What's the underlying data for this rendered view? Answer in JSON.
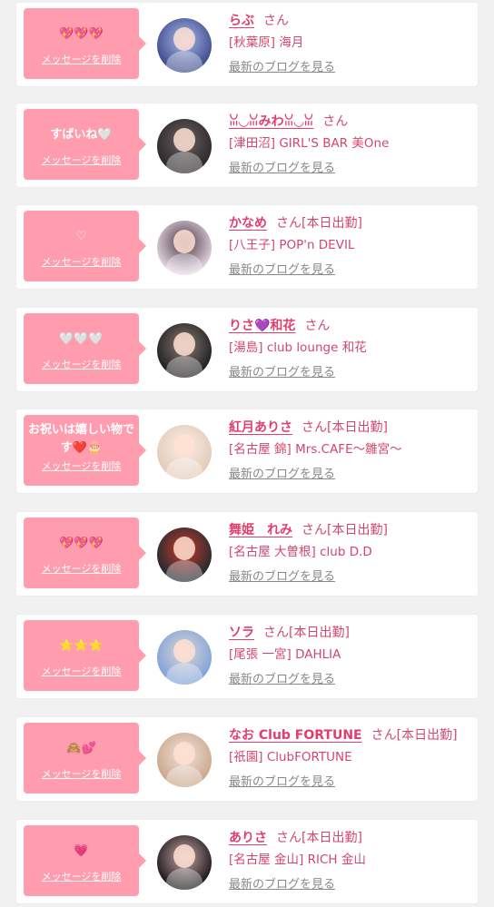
{
  "delete_label": "メッセージを削除",
  "blog_label": "最新のブログを見る",
  "san_label": "さん",
  "colors": {
    "bubble": "#ff9cad",
    "accent": "#e23e6b",
    "shop": "#d4476c",
    "link": "#888888"
  },
  "cards": [
    {
      "message": "💖💖💖",
      "name": "らぶ",
      "status": "",
      "shop": "[秋葉原] 海月",
      "avatar_colors": [
        "#3a4a8a",
        "#a9b7e8"
      ]
    },
    {
      "message": "すばいね🤍",
      "name": "ꈍ◡ꈍみわꈍ◡ꈍ",
      "status": "",
      "shop": "[津田沼] GIRL'S BAR 美One",
      "avatar_colors": [
        "#2a2628",
        "#6c6264"
      ]
    },
    {
      "message": "♡",
      "name": "かなめ",
      "status": "[本日出勤]",
      "shop": "[八王子] POP'n DEVIL",
      "avatar_colors": [
        "#e8d8e6",
        "#4a3a44"
      ]
    },
    {
      "message": "🤍🤍🤍",
      "name": "りさ💜和花",
      "status": "",
      "shop": "[湯島] club lounge 和花",
      "avatar_colors": [
        "#1d1d1f",
        "#8a7a72"
      ]
    },
    {
      "message": "お祝いは嬉しい物です❤️🎂",
      "name": "紅月ありさ",
      "status": "[本日出勤]",
      "shop": "[名古屋 錦] Mrs.CAFE～雛宮～",
      "avatar_colors": [
        "#e4c9b6",
        "#f6eee6"
      ]
    },
    {
      "message": "💖💖💖",
      "name": "舞姫　れみ",
      "status": "[本日出勤]",
      "shop": "[名古屋 大曽根] club D.D",
      "avatar_colors": [
        "#1f2a30",
        "#c73a2c"
      ]
    },
    {
      "message": "⭐⭐⭐",
      "name": "ソラ",
      "status": "[本日出勤]",
      "shop": "[尾張 一宮] DAHLIA",
      "avatar_colors": [
        "#7ea0d8",
        "#dcd7d6"
      ]
    },
    {
      "message": "🙈💕",
      "name": "なお Club FORTUNE",
      "status": "[本日出勤]",
      "shop": "[祇園] ClubFORTUNE",
      "avatar_colors": [
        "#caa589",
        "#efe4dd"
      ]
    },
    {
      "message": "💗",
      "name": "ありさ",
      "status": "[本日出勤]",
      "shop": "[名古屋 金山] RICH 金山",
      "avatar_colors": [
        "#171416",
        "#c8a6a6"
      ]
    }
  ]
}
